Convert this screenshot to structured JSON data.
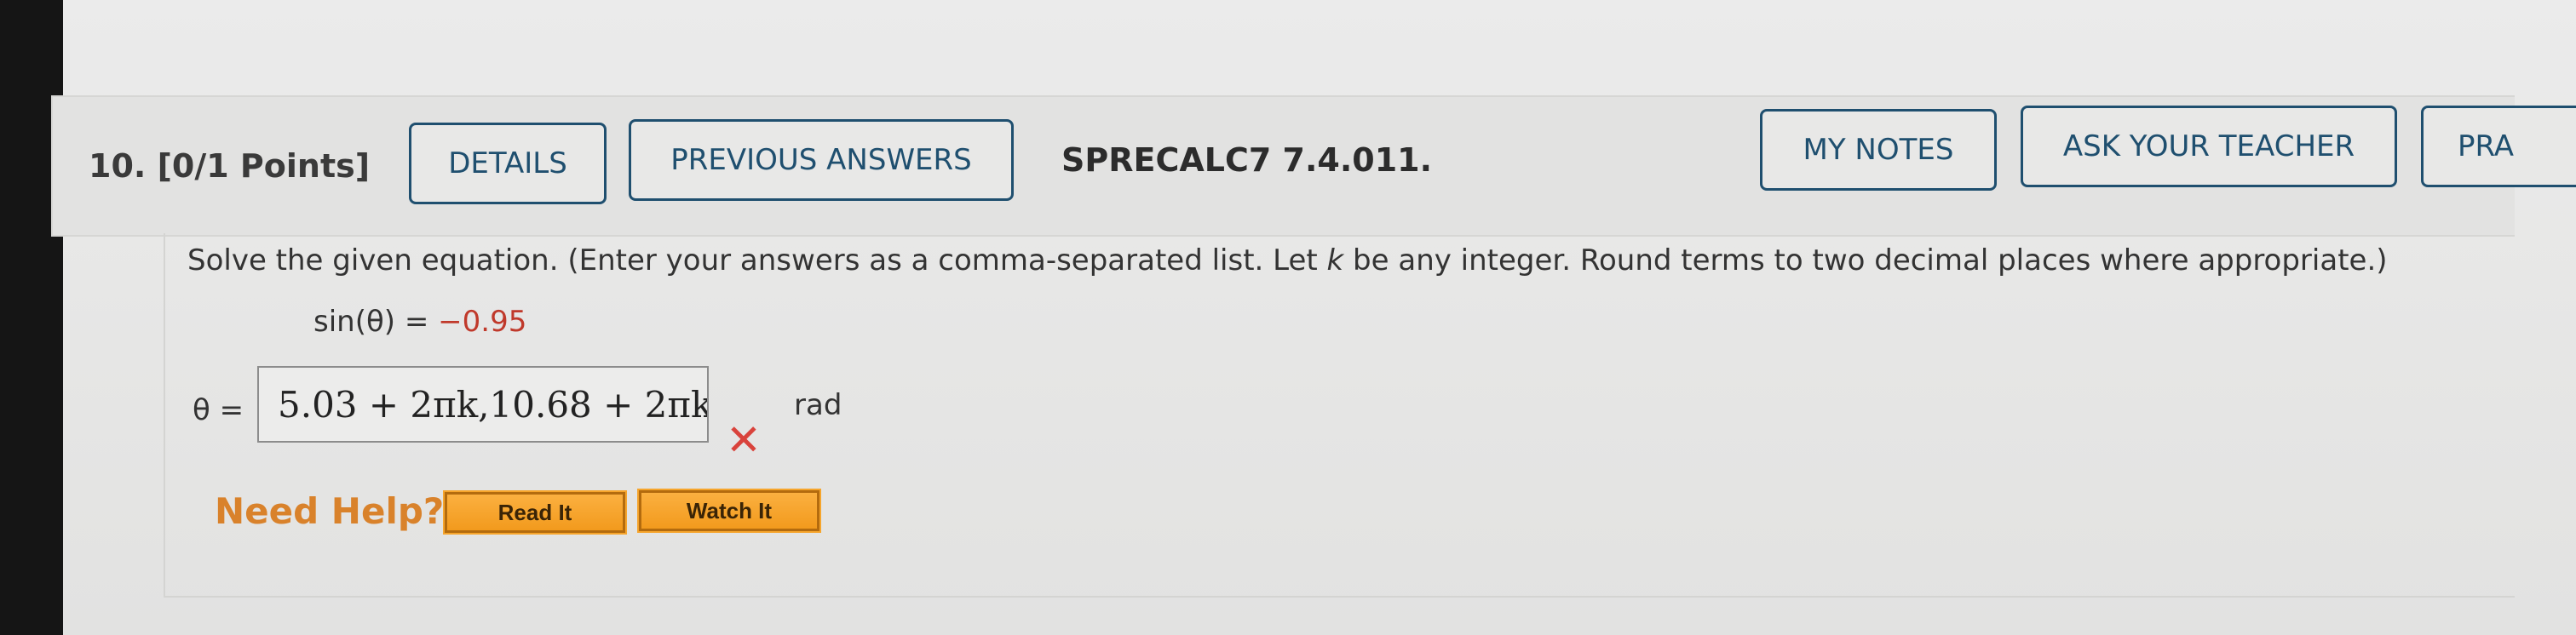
{
  "question": {
    "number_label": "10.",
    "points_label": "[0/1 Points]",
    "reference": "SPRECALC7 7.4.011."
  },
  "toolbar": {
    "details_label": "DETAILS",
    "previous_answers_label": "PREVIOUS ANSWERS",
    "my_notes_label": "MY NOTES",
    "ask_teacher_label": "ASK YOUR TEACHER",
    "practice_label": "PRA"
  },
  "problem": {
    "instructions_before_k": "Solve the given equation. (Enter your answers as a comma-separated list. Let ",
    "variable_k": "k",
    "instructions_after_k": " be any integer. Round terms to two decimal places where appropriate.)",
    "equation_lhs": "sin(θ) = ",
    "equation_rhs": "−0.95"
  },
  "answer": {
    "label": "θ =",
    "value": "5.03 + 2πk,10.68 + 2πk",
    "status": "incorrect",
    "status_icon": "x-mark-icon",
    "unit": "rad"
  },
  "help": {
    "label": "Need Help?",
    "read_it_label": "Read It",
    "watch_it_label": "Watch It"
  },
  "colors": {
    "button_border": "#1f4f6f",
    "negative_value": "#c0392b",
    "incorrect_mark": "#d9433c",
    "help_label": "#d9822b",
    "help_button": "#f29a1d"
  }
}
